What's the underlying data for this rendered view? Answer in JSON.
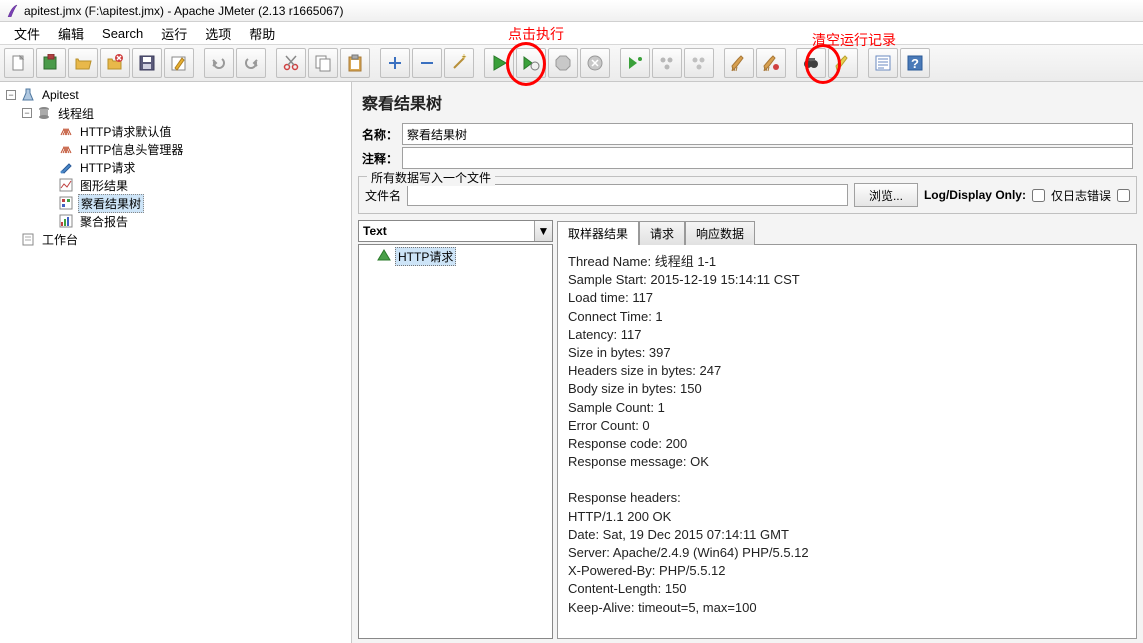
{
  "title": "apitest.jmx (F:\\apitest.jmx) - Apache JMeter (2.13 r1665067)",
  "menu": [
    "文件",
    "编辑",
    "Search",
    "运行",
    "选项",
    "帮助"
  ],
  "tree": {
    "root": "Apitest",
    "threadGroup": "线程组",
    "items": [
      "HTTP请求默认值",
      "HTTP信息头管理器",
      "HTTP请求",
      "图形结果",
      "察看结果树",
      "聚合报告"
    ],
    "workbench": "工作台"
  },
  "panel": {
    "title": "察看结果树",
    "nameLabel": "名称：",
    "nameValue": "察看结果树",
    "commentLabel": "注释：",
    "commentValue": "",
    "fieldsetTitle": "所有数据写入一个文件",
    "fileLabel": "文件名",
    "browseLabel": "浏览...",
    "logDisplayLabel": "Log/Display Only:",
    "errorsOnlyLabel": "仅日志错误"
  },
  "dropdown": "Text",
  "sampler": "HTTP请求",
  "tabs": [
    "取样器结果",
    "请求",
    "响应数据"
  ],
  "result": {
    "l1": "Thread Name: 线程组 1-1",
    "l2": "Sample Start: 2015-12-19 15:14:11 CST",
    "l3": "Load time: 117",
    "l4": "Connect Time: 1",
    "l5": "Latency: 117",
    "l6": "Size in bytes: 397",
    "l7": "Headers size in bytes: 247",
    "l8": "Body size in bytes: 150",
    "l9": "Sample Count: 1",
    "l10": "Error Count: 0",
    "l11": "Response code: 200",
    "l12": "Response message: OK",
    "l13": "",
    "l14": "Response headers:",
    "l15": "HTTP/1.1 200 OK",
    "l16": "Date: Sat, 19 Dec 2015 07:14:11 GMT",
    "l17": "Server: Apache/2.4.9 (Win64) PHP/5.5.12",
    "l18": "X-Powered-By: PHP/5.5.12",
    "l19": "Content-Length: 150",
    "l20": "Keep-Alive: timeout=5, max=100"
  },
  "annotations": {
    "run": "点击执行",
    "clear": "清空运行记录"
  }
}
